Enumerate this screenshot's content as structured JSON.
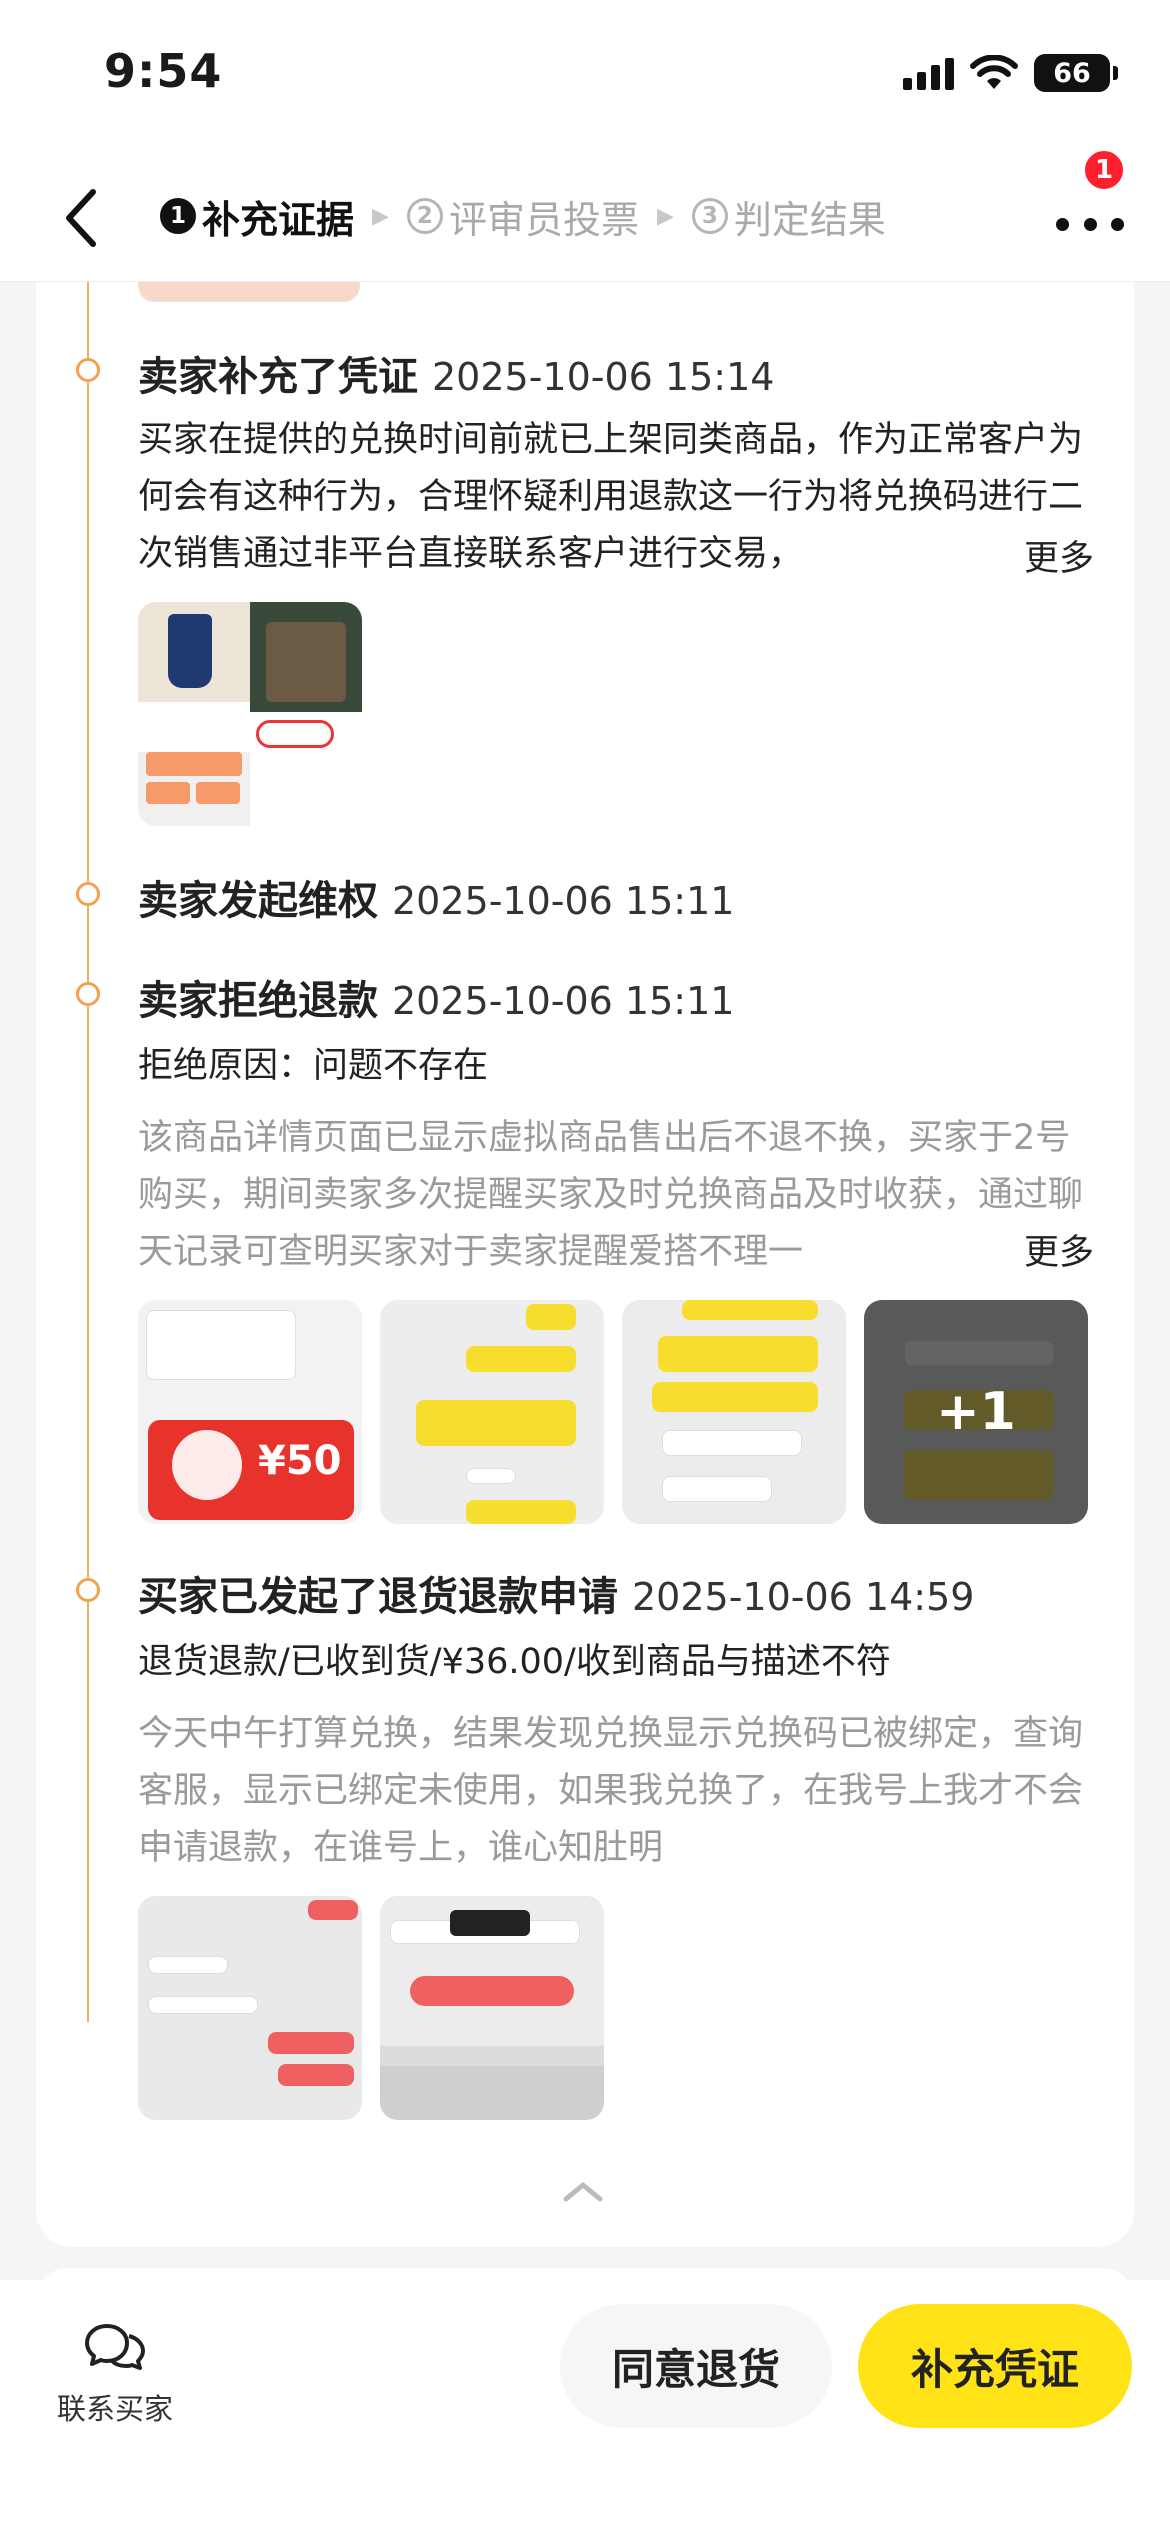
{
  "status_bar": {
    "time": "9:54",
    "battery": "66"
  },
  "nav": {
    "badge_count": "1",
    "steps": [
      {
        "num": "1",
        "label": "补充证据"
      },
      {
        "num": "2",
        "label": "评审员投票"
      },
      {
        "num": "3",
        "label": "判定结果"
      }
    ]
  },
  "timeline": {
    "more_label": "更多",
    "events": [
      {
        "title": "卖家补充了凭证",
        "time": "2025-10-06 15:14",
        "text": "买家在提供的兑换时间前就已上架同类商品，作为正常客户为何会有这种行为，合理怀疑利用退款这一行为将兑换码进行二次销售通过非平台直接联系客户进行交易，"
      },
      {
        "title": "卖家发起维权",
        "time": "2025-10-06 15:11"
      },
      {
        "title": "卖家拒绝退款",
        "time": "2025-10-06 15:11",
        "reason": "拒绝原因：问题不存在",
        "text": "该商品详情页面已显示虚拟商品售出后不退不换，买家于2号购买，期间卖家多次提醒买家及时兑换商品及时收获，通过聊天记录可查明买家对于卖家提醒爱搭不理一",
        "image_overflow": "+1",
        "coupon_value": "¥50"
      },
      {
        "title": "买家已发起了退货退款申请",
        "time": "2025-10-06 14:59",
        "detail": "退货退款/已收到货/¥36.00/收到商品与描述不符",
        "text": "今天中午打算兑换，结果发现兑换显示兑换码已被绑定，查询客服，显示已绑定未使用，如果我兑换了，在我号上我才不会申请退款，在谁号上，谁心知肚明"
      }
    ]
  },
  "bottom_bar": {
    "contact_label": "联系买家",
    "agree_label": "同意退货",
    "supplement_label": "补充凭证"
  }
}
